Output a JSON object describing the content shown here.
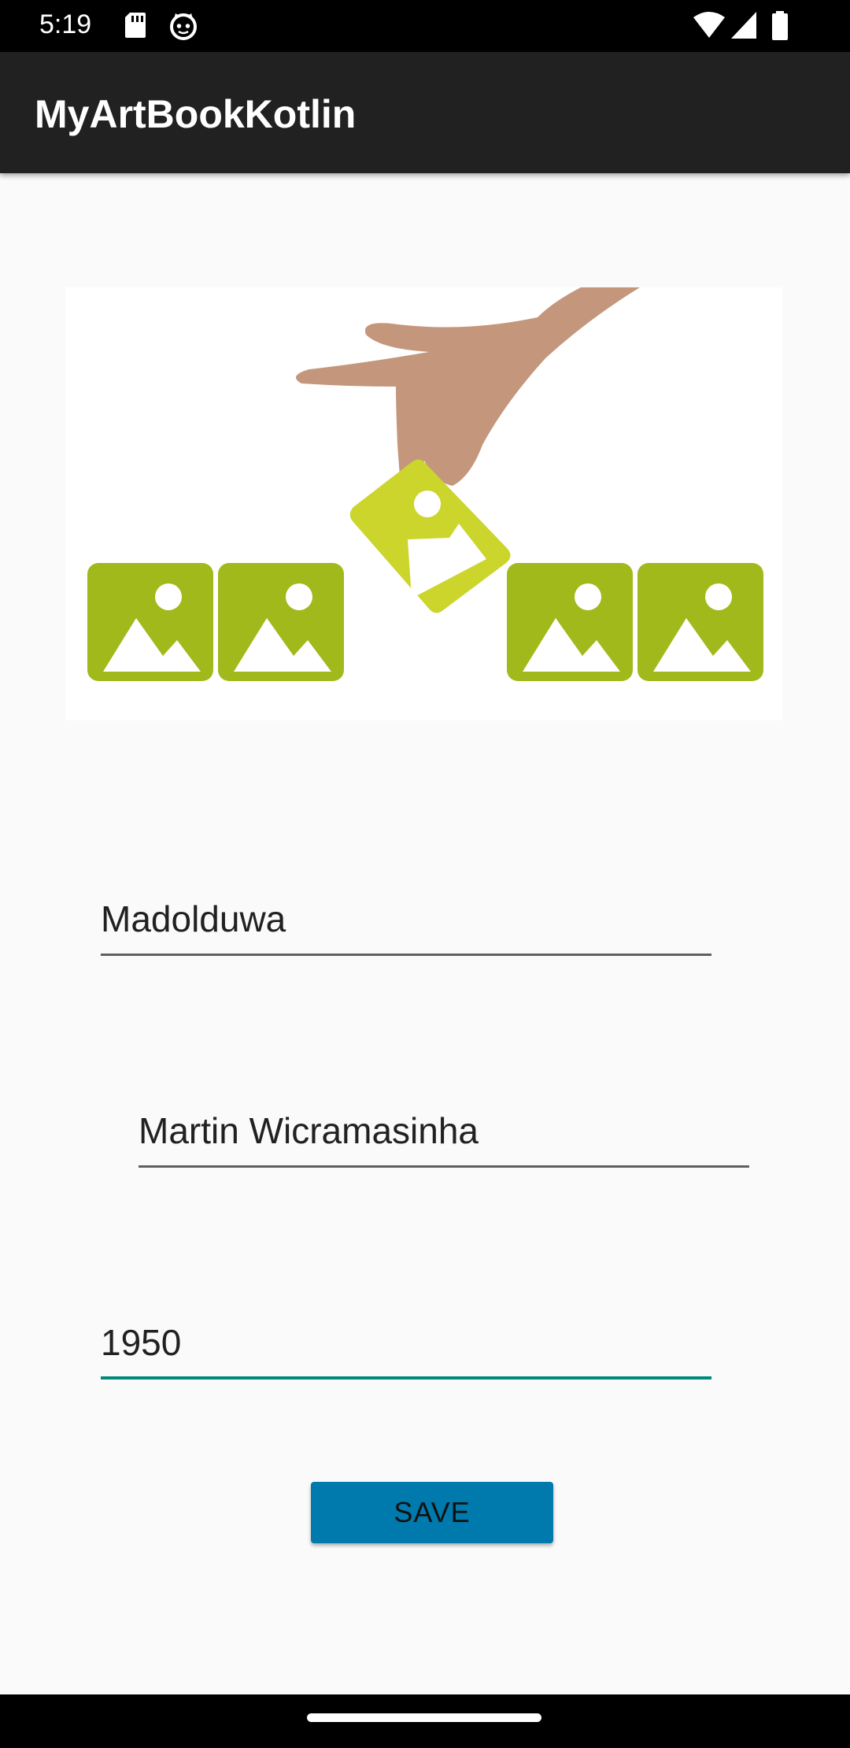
{
  "status_bar": {
    "time": "5:19",
    "icons": [
      "sd-card-icon",
      "cat-face-icon",
      "wifi-icon",
      "cell-signal-icon",
      "battery-icon"
    ]
  },
  "app_bar": {
    "title": "MyArtBookKotlin"
  },
  "form": {
    "name_value": "Madolduwa",
    "artist_value": "Martin Wicramasinha",
    "year_value": "1950",
    "save_label": "SAVE"
  },
  "colors": {
    "app_bar": "#212121",
    "background": "#fafafa",
    "accent": "#00897b",
    "button": "#0079ad",
    "image_green": "#a2b91b",
    "image_green_light": "#cbd52c",
    "hand": "#c4967c"
  }
}
